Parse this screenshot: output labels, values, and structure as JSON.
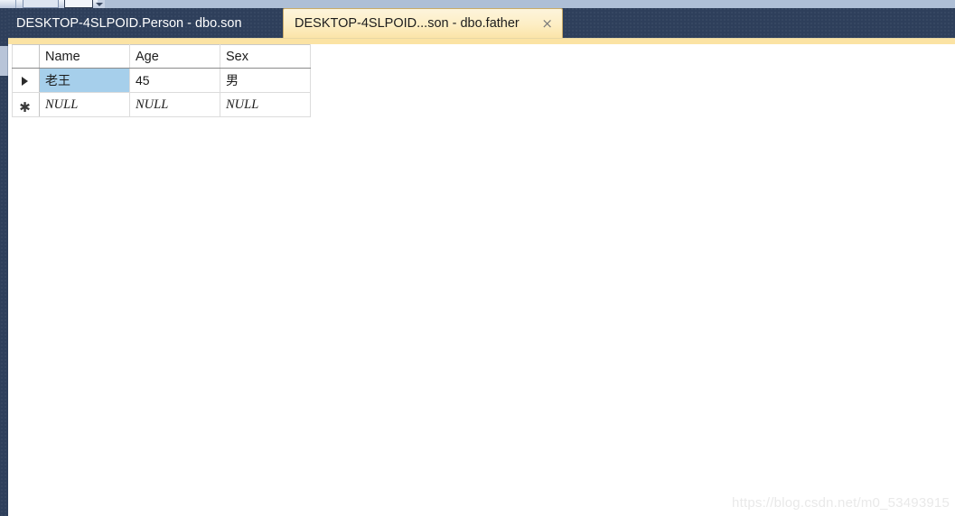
{
  "toolbar": {
    "overflow_caret_icon": "chevron-down-icon"
  },
  "tabs": [
    {
      "label": "DESKTOP-4SLPOID.Person - dbo.son",
      "active": false,
      "closable": false
    },
    {
      "label": "DESKTOP-4SLPOID...son - dbo.father",
      "active": true,
      "closable": true,
      "close_glyph": "×"
    }
  ],
  "grid": {
    "row_header_current_glyph": "▶",
    "row_header_newrow_glyph": "✱",
    "columns": [
      "",
      "Name",
      "Age",
      "Sex"
    ],
    "rows": [
      {
        "indicator": "current",
        "cells": [
          "老王",
          "45",
          "男"
        ],
        "selected_cell_index": 0
      },
      {
        "indicator": "new",
        "cells": [
          "NULL",
          "NULL",
          "NULL"
        ],
        "selected_cell_index": -1
      }
    ]
  },
  "watermark": {
    "text": "https://blog.csdn.net/m0_53493915"
  },
  "colors": {
    "tab_bar_background": "#2e3f5b",
    "active_tab_background": "#fbeec4",
    "active_tab_border": "#c9ab6a",
    "tab_underline": "#fbe3a4",
    "selection_highlight": "#a6cfeb",
    "grid_line": "#dcdcdc",
    "header_rule": "#8a8a8a",
    "watermark_text": "#e9e9e9"
  }
}
